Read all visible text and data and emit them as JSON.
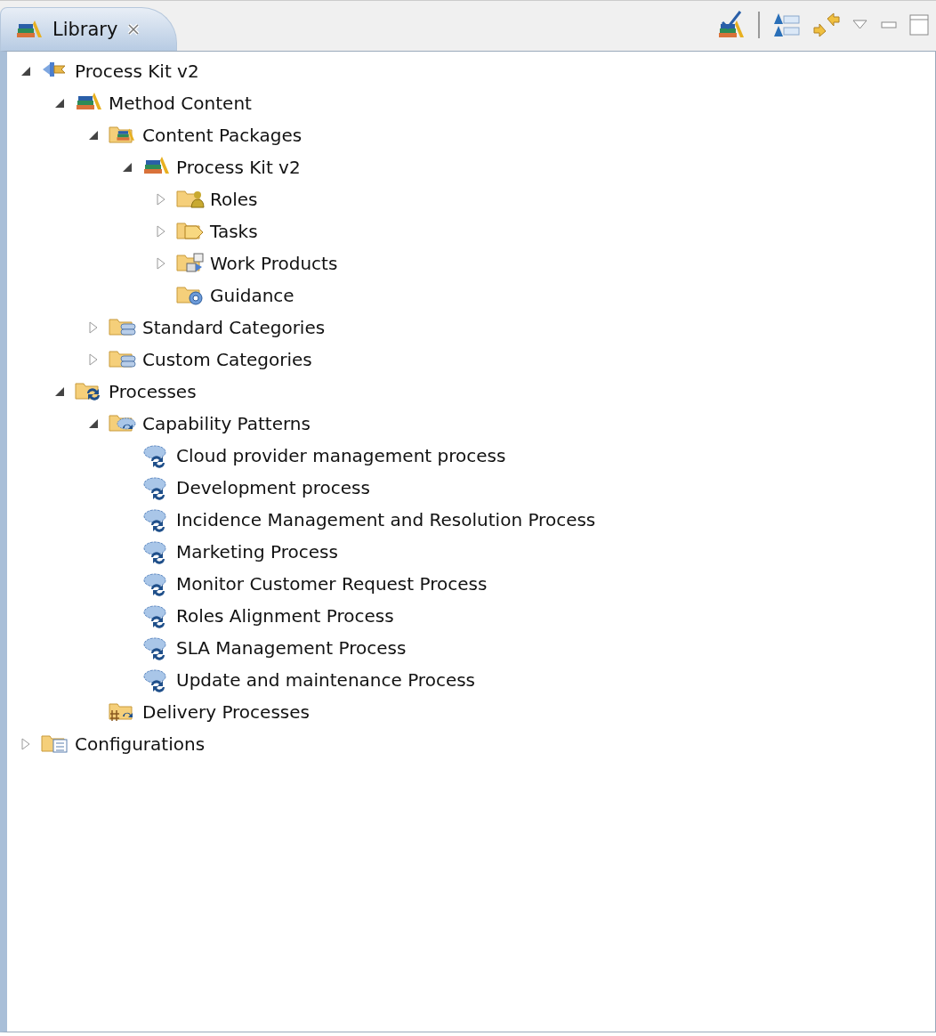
{
  "view_tab": {
    "title": "Library",
    "selected": true
  },
  "tree": [
    {
      "label": "Process Kit v2",
      "kind": "plugin",
      "expanded": true,
      "children": [
        {
          "label": "Method Content",
          "kind": "library",
          "expanded": true,
          "children": [
            {
              "label": "Content Packages",
              "kind": "packages",
              "expanded": true,
              "children": [
                {
                  "label": "Process Kit v2",
                  "kind": "library",
                  "expanded": true,
                  "children": [
                    {
                      "label": "Roles",
                      "kind": "roles",
                      "expanded": false
                    },
                    {
                      "label": "Tasks",
                      "kind": "tasks",
                      "expanded": false
                    },
                    {
                      "label": "Work Products",
                      "kind": "workproducts",
                      "expanded": false
                    },
                    {
                      "label": "Guidance",
                      "kind": "guidance"
                    }
                  ]
                }
              ]
            },
            {
              "label": "Standard Categories",
              "kind": "categories",
              "expanded": false
            },
            {
              "label": "Custom Categories",
              "kind": "categories",
              "expanded": false
            }
          ]
        },
        {
          "label": "Processes",
          "kind": "processes",
          "expanded": true,
          "children": [
            {
              "label": "Capability Patterns",
              "kind": "capabilities",
              "expanded": true,
              "children": [
                {
                  "label": "Cloud provider management process",
                  "kind": "process"
                },
                {
                  "label": "Development process",
                  "kind": "process"
                },
                {
                  "label": "Incidence Management and Resolution Process",
                  "kind": "process"
                },
                {
                  "label": "Marketing Process",
                  "kind": "process"
                },
                {
                  "label": "Monitor Customer Request Process",
                  "kind": "process"
                },
                {
                  "label": "Roles Alignment Process",
                  "kind": "process"
                },
                {
                  "label": "SLA Management Process",
                  "kind": "process"
                },
                {
                  "label": "Update and maintenance Process",
                  "kind": "process"
                }
              ]
            },
            {
              "label": "Delivery Processes",
              "kind": "delivery"
            }
          ]
        }
      ]
    },
    {
      "label": "Configurations",
      "kind": "configurations",
      "expanded": false
    }
  ]
}
